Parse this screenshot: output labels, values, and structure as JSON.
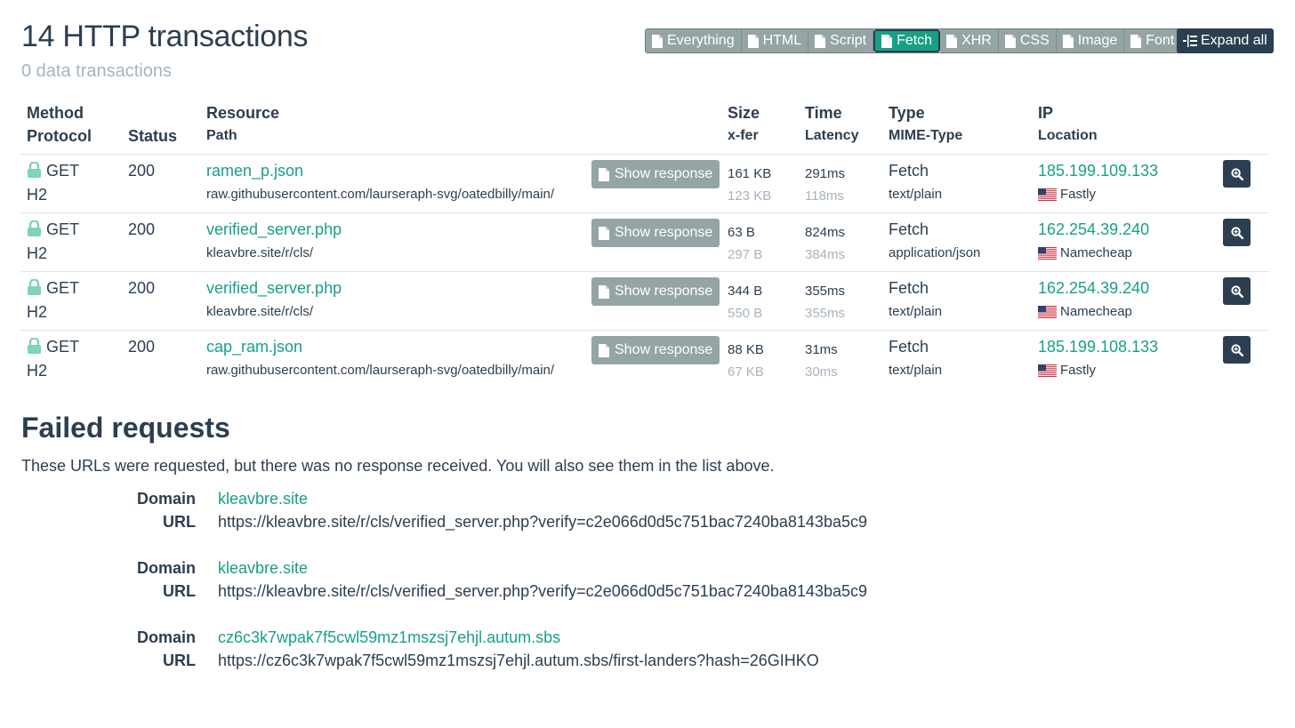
{
  "header": {
    "title": "14 HTTP transactions",
    "subtitle": "0 data transactions"
  },
  "filters": [
    {
      "label": "Everything",
      "active": false
    },
    {
      "label": "HTML",
      "active": false
    },
    {
      "label": "Script",
      "active": false
    },
    {
      "label": "Fetch",
      "active": true
    },
    {
      "label": "XHR",
      "active": false
    },
    {
      "label": "CSS",
      "active": false
    },
    {
      "label": "Image",
      "active": false
    },
    {
      "label": "Font",
      "active": false
    }
  ],
  "expand_label": "Expand all",
  "table": {
    "headers": {
      "method": "Method",
      "protocol": "Protocol",
      "status": "Status",
      "resource": "Resource",
      "path": "Path",
      "size": "Size",
      "xfer": "x-fer",
      "time": "Time",
      "latency": "Latency",
      "type": "Type",
      "mime": "MIME-Type",
      "ip": "IP",
      "location": "Location"
    },
    "show_response_label": "Show response",
    "rows": [
      {
        "method": "GET",
        "protocol": "H2",
        "status": "200",
        "name": "ramen_p.json",
        "path": "raw.githubusercontent.com/laurseraph-svg/oatedbilly/main/",
        "size": "161 KB",
        "xfer": "123 KB",
        "time": "291ms",
        "latency": "118ms",
        "type": "Fetch",
        "mime": "text/plain",
        "ip": "185.199.109.133",
        "location": "Fastly"
      },
      {
        "method": "GET",
        "protocol": "H2",
        "status": "200",
        "name": "verified_server.php",
        "path": "kleavbre.site/r/cls/",
        "size": "63 B",
        "xfer": "297 B",
        "time": "824ms",
        "latency": "384ms",
        "type": "Fetch",
        "mime": "application/json",
        "ip": "162.254.39.240",
        "location": "Namecheap"
      },
      {
        "method": "GET",
        "protocol": "H2",
        "status": "200",
        "name": "verified_server.php",
        "path": "kleavbre.site/r/cls/",
        "size": "344 B",
        "xfer": "550 B",
        "time": "355ms",
        "latency": "355ms",
        "type": "Fetch",
        "mime": "text/plain",
        "ip": "162.254.39.240",
        "location": "Namecheap"
      },
      {
        "method": "GET",
        "protocol": "H2",
        "status": "200",
        "name": "cap_ram.json",
        "path": "raw.githubusercontent.com/laurseraph-svg/oatedbilly/main/",
        "size": "88 KB",
        "xfer": "67 KB",
        "time": "31ms",
        "latency": "30ms",
        "type": "Fetch",
        "mime": "text/plain",
        "ip": "185.199.108.133",
        "location": "Fastly"
      }
    ]
  },
  "failed": {
    "title": "Failed requests",
    "description": "These URLs were requested, but there was no response received. You will also see them in the list above.",
    "domain_label": "Domain",
    "url_label": "URL",
    "entries": [
      {
        "domain": "kleavbre.site",
        "url": "https://kleavbre.site/r/cls/verified_server.php?verify=c2e066d0d5c751bac7240ba8143ba5c9"
      },
      {
        "domain": "kleavbre.site",
        "url": "https://kleavbre.site/r/cls/verified_server.php?verify=c2e066d0d5c751bac7240ba8143ba5c9"
      },
      {
        "domain": "cz6c3k7wpak7f5cwl59mz1mszsj7ehjl.autum.sbs",
        "url": "https://cz6c3k7wpak7f5cwl59mz1mszsj7ehjl.autum.sbs/first-landers?hash=26GIHKO"
      }
    ]
  },
  "icons": {
    "filter": "file-icon",
    "expand": "expand-icon",
    "lock": "lock-icon",
    "zoom": "zoom-icon",
    "flag": "us-flag-icon"
  },
  "colors": {
    "primary": "#2c3e50",
    "accent": "#18a085",
    "muted": "#a8b3bd",
    "button_grey": "#95a5a6",
    "lock": "#7ed3b8"
  }
}
